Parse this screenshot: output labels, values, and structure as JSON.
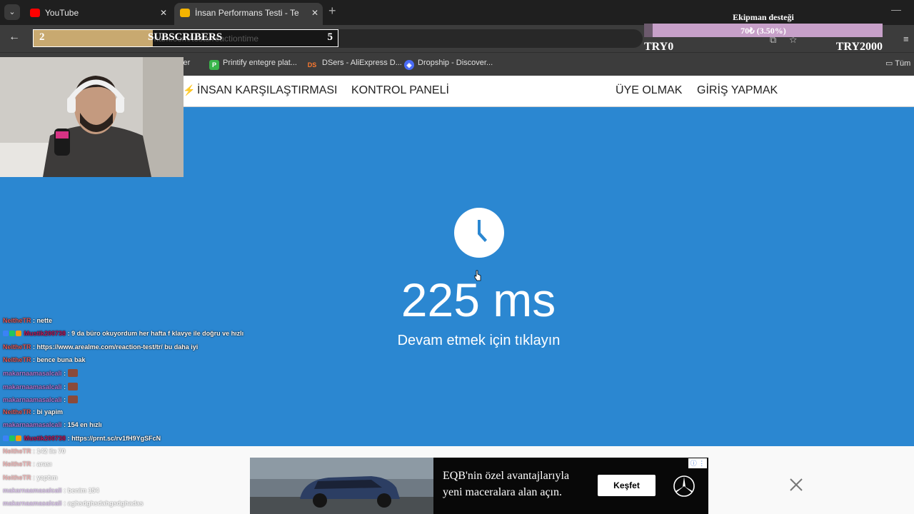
{
  "browser": {
    "tabs": [
      {
        "title": "YouTube",
        "favicon": "youtube-icon",
        "active": false
      },
      {
        "title": "İnsan Performans Testi - Tepki S",
        "favicon": "lightning-icon",
        "active": true
      }
    ],
    "address": "mark.com/tests/reactiontime",
    "bookmarks": [
      "Printify entegre plat...",
      "DSers - AliExpress D...",
      "Dropship - Discover..."
    ],
    "bookmark_partial": "...unter",
    "all_bookmarks": "Tüm"
  },
  "site_nav": {
    "compare": "İNSAN KARŞILAŞTIRMASI",
    "dashboard": "KONTROL PANELİ",
    "signup": "ÜYE OLMAK",
    "login": "GİRİŞ YAPMAK"
  },
  "test": {
    "result": "225 ms",
    "instruction": "Devam etmek için tıklayın",
    "accent": "#2b87d1"
  },
  "overlay": {
    "subscribers": {
      "left": "2",
      "label": "SUBSCRIBERS",
      "right": "5",
      "progress": 0.4
    },
    "donation": {
      "title": "Ekipman desteği",
      "value": "70₺ (3.50%)",
      "progress": 0.035,
      "min": "TRY0",
      "max": "TRY2000"
    }
  },
  "chat": [
    {
      "user": "NeitheTR",
      "color": "#e05a5a",
      "text": "nette"
    },
    {
      "user": "Mustik200738",
      "color": "#c2185b",
      "text": "9 da büro okuyordum her hafta f klavye ile doğru ve hızlı",
      "badges": true
    },
    {
      "user": "NeitheTR",
      "color": "#e05a5a",
      "text": "https://www.arealme.com/reaction-test/tr/ bu daha iyi"
    },
    {
      "user": "NeitheTR",
      "color": "#e05a5a",
      "text": "bence buna bak"
    },
    {
      "user": "makarnaamasalcali",
      "color": "#b07ad6",
      "text": "",
      "emote": true
    },
    {
      "user": "makarnaamasalcali",
      "color": "#b07ad6",
      "text": "",
      "emote": true
    },
    {
      "user": "makarnaamasalcali",
      "color": "#b07ad6",
      "text": "",
      "emote": true
    },
    {
      "user": "NeitheTR",
      "color": "#e05a5a",
      "text": "bi yapim"
    },
    {
      "user": "makarnaamasalcali",
      "color": "#b07ad6",
      "text": "154 en hızlı"
    },
    {
      "user": "Mustik200738",
      "color": "#c2185b",
      "text": "https://prnt.sc/rv1fH9YgSFcN",
      "badges": true
    },
    {
      "user": "NeitheTR",
      "color": "#e05a5a",
      "text": "142 ile 70"
    },
    {
      "user": "NeitheTR",
      "color": "#e05a5a",
      "text": "arası"
    },
    {
      "user": "NeitheTR",
      "color": "#e05a5a",
      "text": "yaptım"
    },
    {
      "user": "makarnaamasalcali",
      "color": "#b07ad6",
      "text": "benim 154"
    },
    {
      "user": "makarnaamasalcali",
      "color": "#b07ad6",
      "text": "aghsdghsdahgsdghadas"
    }
  ],
  "ad": {
    "text": "EQB'nin özel avantajlarıyla yeni maceralara alan açın.",
    "button": "Keşfet",
    "logo": "mercedes-star-icon"
  }
}
